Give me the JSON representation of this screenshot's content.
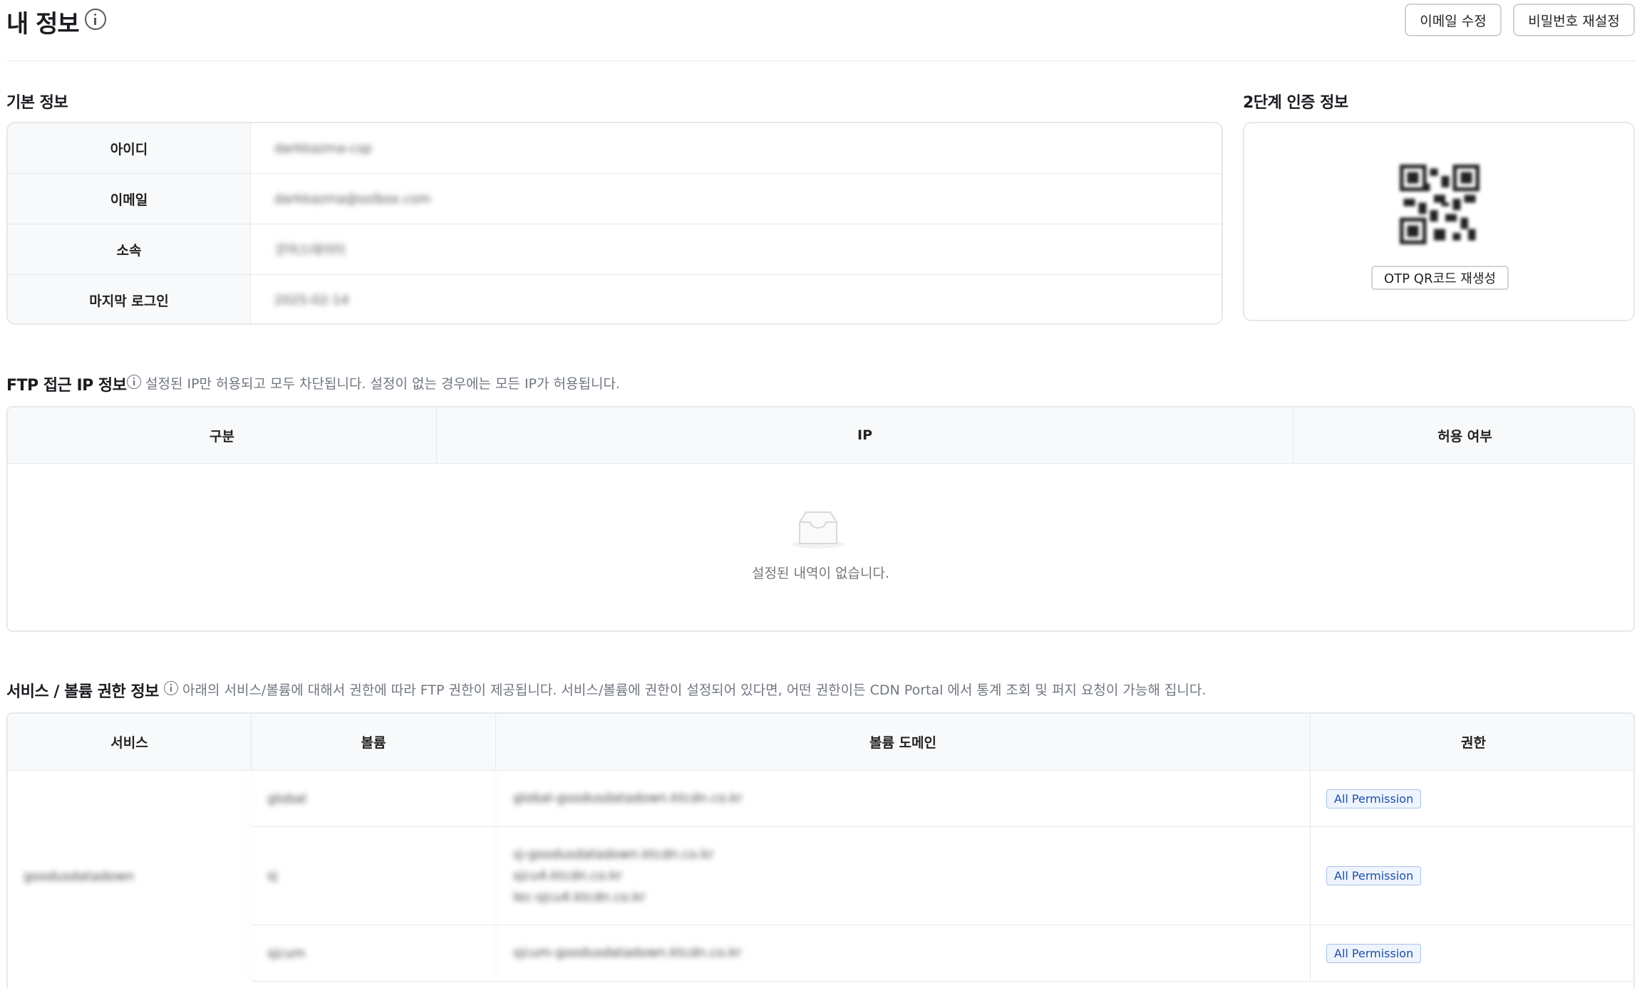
{
  "header": {
    "title": "내 정보",
    "email_button": "이메일 수정",
    "password_button": "비밀번호 재설정"
  },
  "basic_info": {
    "title": "기본 정보",
    "rows": [
      {
        "label": "아이디",
        "value": "darkkazma-csp"
      },
      {
        "label": "이메일",
        "value": "darkkazma@solbox.com"
      },
      {
        "label": "소속",
        "value": "굿어스데이터"
      },
      {
        "label": "마지막 로그인",
        "value": "2025-02-14"
      }
    ]
  },
  "otp": {
    "title": "2단계 인증 정보",
    "regen_button": "OTP QR코드 재생성"
  },
  "ftp": {
    "title": "FTP 접근 IP 정보",
    "hint": "설정된 IP만 허용되고 모두 차단됩니다. 설정이 없는 경우에는 모든 IP가 허용됩니다.",
    "columns": [
      "구분",
      "IP",
      "허용 여부"
    ],
    "empty_text": "설정된 내역이 없습니다."
  },
  "services": {
    "title": "서비스 / 볼륨 권한 정보",
    "hint": "아래의 서비스/볼륨에 대해서 권한에 따라 FTP 권한이 제공됩니다. 서비스/볼륨에 권한이 설정되어 있다면, 어떤 권한이든 CDN Portal 에서 통계 조회 및 퍼지 요청이 가능해 집니다.",
    "columns": [
      "서비스",
      "볼륨",
      "볼륨 도메인",
      "권한"
    ],
    "service_name": "goodusdatadown",
    "rows": [
      {
        "volume": "global",
        "domains": [
          "global-goodusdatadown.ktcdn.co.kr"
        ],
        "permission": "All Permission"
      },
      {
        "volume": "sj",
        "domains": [
          "sj-goodusdatadown.ktcdn.co.kr",
          "sjcu4.ktcdn.co.kr",
          "lec-sjcu4.ktcdn.co.kr"
        ],
        "permission": "All Permission"
      },
      {
        "volume": "sjcum",
        "domains": [
          "sjcum-goodusdatadown.ktcdn.co.kr"
        ],
        "permission": "All Permission"
      }
    ]
  }
}
